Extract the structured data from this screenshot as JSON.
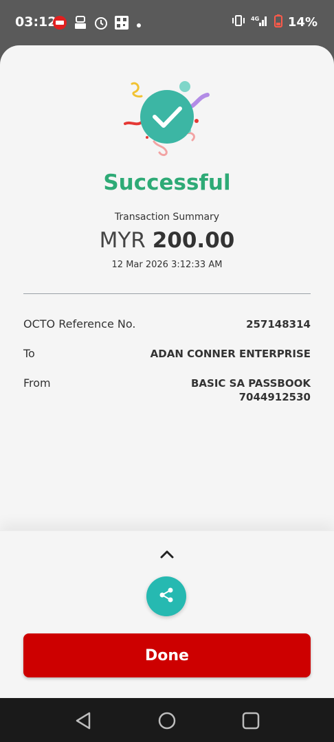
{
  "status_bar": {
    "time": "03:12",
    "battery_percent": "14%",
    "icons": [
      "cimb-app-icon",
      "robot-icon",
      "alarm-icon",
      "qr-code-icon",
      "dot-icon",
      "vibrate-icon",
      "signal-icon",
      "battery-low-icon"
    ]
  },
  "receipt": {
    "status_title": "Successful",
    "summary_label": "Transaction Summary",
    "currency": "MYR",
    "amount": "200.00",
    "datetime": "12 Mar 2026 3:12:33 AM",
    "details": [
      {
        "label": "OCTO Reference No.",
        "value_lines": [
          "257148314"
        ]
      },
      {
        "label": "To",
        "value_lines": [
          "ADAN CONNER ENTERPRISE"
        ]
      },
      {
        "label": "From",
        "value_lines": [
          "BASIC SA PASSBOOK",
          "7044912530"
        ]
      }
    ]
  },
  "actions": {
    "expand_icon": "chevron-up-icon",
    "share_icon": "share-icon",
    "done_label": "Done"
  },
  "nav_bar": {
    "icons": [
      "back-icon",
      "home-icon",
      "recents-icon"
    ]
  },
  "colors": {
    "success_green": "#2eaa76",
    "check_teal": "#3cb6a4",
    "share_teal": "#26b9b1",
    "done_red": "#cd0000",
    "sheet_bg": "#f5f5f5",
    "status_bg": "#5a5a5a"
  }
}
